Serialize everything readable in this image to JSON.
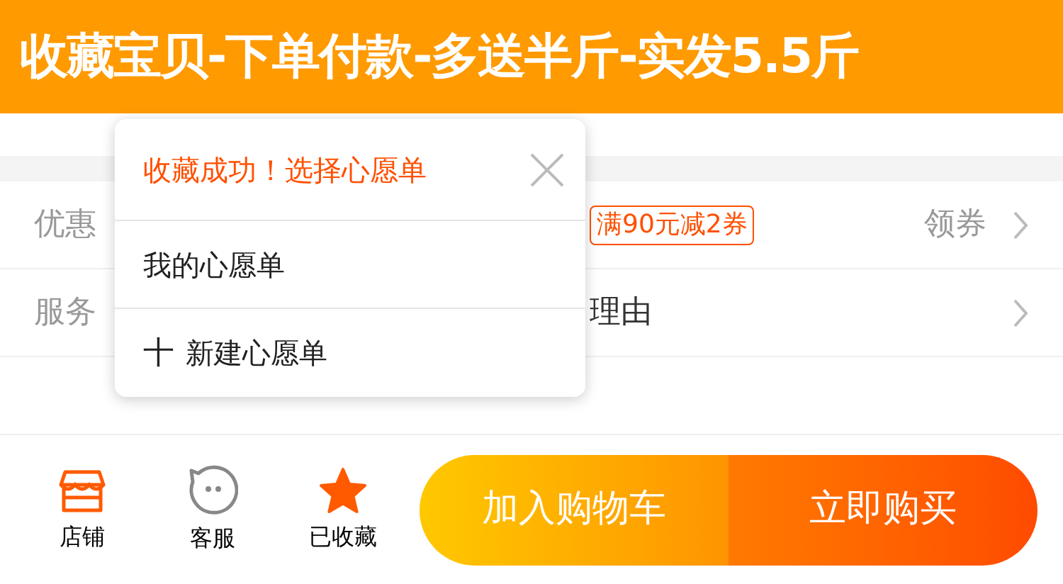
{
  "banner": {
    "title": "收藏宝贝-下单付款-多送半斤-实发5.5斤"
  },
  "rows": [
    {
      "label": "优惠",
      "coupon": "满90元减2券",
      "action": "领券"
    },
    {
      "label": "服务",
      "text": "理由"
    }
  ],
  "popup": {
    "title": "收藏成功！选择心愿单",
    "items": [
      {
        "kind": "list",
        "label": "我的心愿单"
      },
      {
        "kind": "create",
        "icon": "十",
        "label": "新建心愿单"
      }
    ]
  },
  "bottom_bar": {
    "icons": [
      {
        "kind": "store",
        "label": "店铺"
      },
      {
        "kind": "service",
        "label": "客服"
      },
      {
        "kind": "favorite",
        "label": "已收藏",
        "favorited": true
      }
    ],
    "buttons": [
      {
        "kind": "cart",
        "label": "加入购物车"
      },
      {
        "kind": "buy",
        "label": "立即购买"
      }
    ]
  }
}
